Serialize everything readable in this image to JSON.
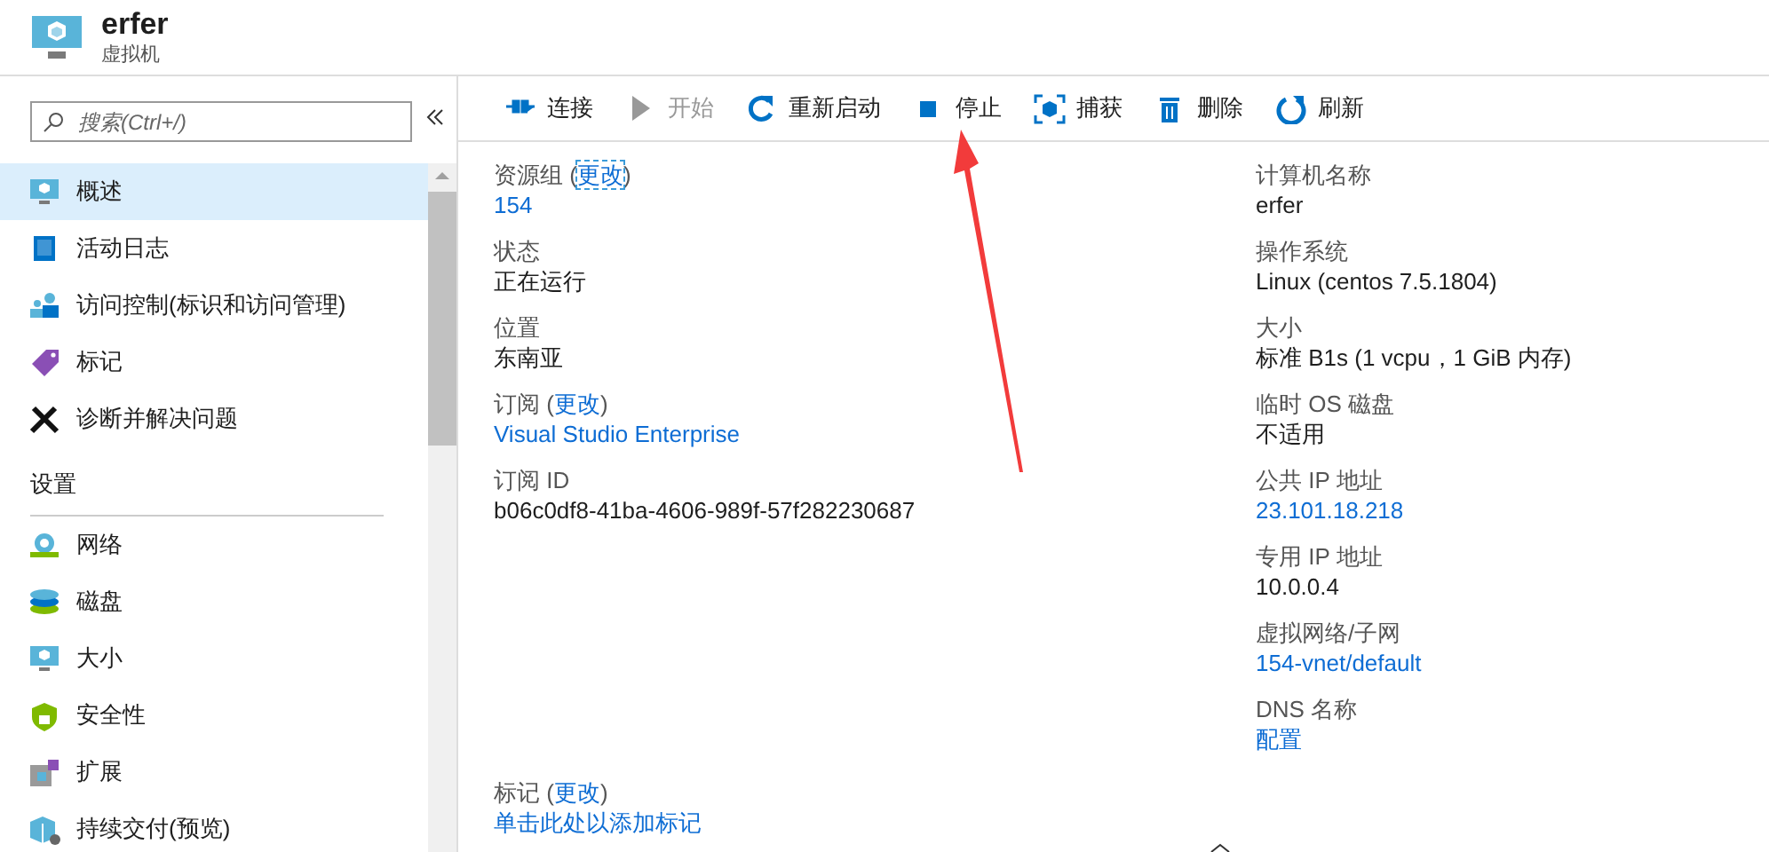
{
  "header": {
    "title": "erfer",
    "subtitle": "虚拟机"
  },
  "search": {
    "placeholder": "搜索(Ctrl+/)"
  },
  "sidebar": {
    "items": [
      {
        "kind": "item",
        "label": "概述",
        "selected": true
      },
      {
        "kind": "item",
        "label": "活动日志",
        "selected": false
      },
      {
        "kind": "item",
        "label": "访问控制(标识和访问管理)",
        "selected": false
      },
      {
        "kind": "item",
        "label": "标记",
        "selected": false
      },
      {
        "kind": "item",
        "label": "诊断并解决问题",
        "selected": false
      },
      {
        "kind": "heading",
        "label": "设置"
      },
      {
        "kind": "item",
        "label": "网络",
        "selected": false
      },
      {
        "kind": "item",
        "label": "磁盘",
        "selected": false
      },
      {
        "kind": "item",
        "label": "大小",
        "selected": false
      },
      {
        "kind": "item",
        "label": "安全性",
        "selected": false
      },
      {
        "kind": "item",
        "label": "扩展",
        "selected": false
      },
      {
        "kind": "item",
        "label": "持续交付(预览)",
        "selected": false
      }
    ]
  },
  "toolbar": {
    "buttons": [
      {
        "label": "连接",
        "disabled": false
      },
      {
        "label": "开始",
        "disabled": true
      },
      {
        "label": "重新启动",
        "disabled": false
      },
      {
        "label": "停止",
        "disabled": false
      },
      {
        "label": "捕获",
        "disabled": false
      },
      {
        "label": "删除",
        "disabled": false
      },
      {
        "label": "刷新",
        "disabled": false
      }
    ]
  },
  "essentials": {
    "left": [
      {
        "label": "资源组 (",
        "change": "更改",
        "close": ")",
        "focused": true,
        "value": "154",
        "link": true
      },
      {
        "label": "状态",
        "value": "正在运行",
        "link": false
      },
      {
        "label": "位置",
        "value": "东南亚",
        "link": false
      },
      {
        "label": "订阅 (",
        "change": "更改",
        "close": ")",
        "focused": false,
        "value": "Visual Studio Enterprise",
        "link": true
      },
      {
        "label": "订阅 ID",
        "value": "b06c0df8-41ba-4606-989f-57f282230687",
        "link": false
      }
    ],
    "right": [
      {
        "label": "计算机名称",
        "value": "erfer",
        "link": false
      },
      {
        "label": "操作系统",
        "value": "Linux (centos 7.5.1804)",
        "link": false
      },
      {
        "label": "大小",
        "value": "标准 B1s (1 vcpu，1 GiB 内存)",
        "link": false
      },
      {
        "label": "临时 OS 磁盘",
        "value": "不适用",
        "link": false
      },
      {
        "label": "公共 IP 地址",
        "value": "23.101.18.218",
        "link": true
      },
      {
        "label": "专用 IP 地址",
        "value": "10.0.0.4",
        "link": false
      },
      {
        "label": "虚拟网络/子网",
        "value": "154-vnet/default",
        "link": true
      },
      {
        "label": "DNS 名称",
        "value": "配置",
        "link": true
      }
    ]
  },
  "tags": {
    "label": "标记 (",
    "change": "更改",
    "close": ")",
    "focused": false,
    "value": "单击此处以添加标记",
    "link": true
  }
}
